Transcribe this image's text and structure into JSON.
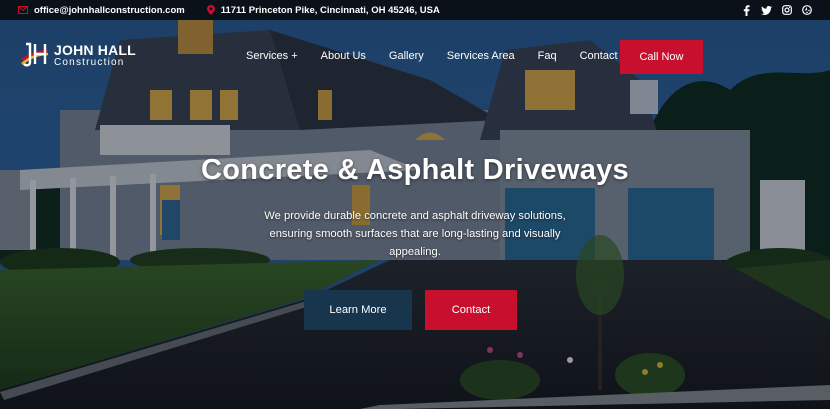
{
  "topbar": {
    "email": "office@johnhallconstruction.com",
    "address": "11711 Princeton Pike, Cincinnati, OH 45246, USA",
    "socials": [
      "facebook-icon",
      "twitter-icon",
      "instagram-icon",
      "yelp-icon"
    ]
  },
  "logo": {
    "name": "JOHN HALL",
    "sub": "Construction"
  },
  "nav": {
    "services": "Services +",
    "about": "About Us",
    "gallery": "Gallery",
    "area": "Services Area",
    "faq": "Faq",
    "contact": "Contact",
    "call_now": "Call Now"
  },
  "hero": {
    "title": "Concrete & Asphalt Driveways",
    "description": "We provide durable concrete and asphalt driveway solutions, ensuring smooth surfaces that are long-lasting and visually appealing.",
    "learn_more": "Learn More",
    "contact": "Contact"
  },
  "colors": {
    "accent": "#c8102e",
    "secondary": "#17354d",
    "topbar": "#0b1118"
  }
}
